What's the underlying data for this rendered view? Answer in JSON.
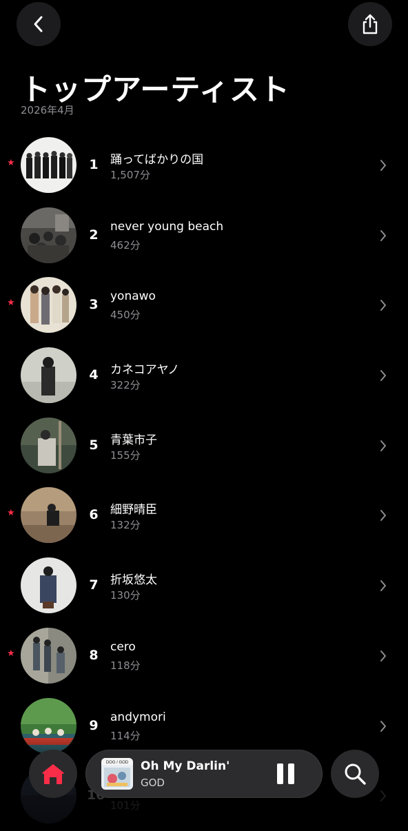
{
  "header": {
    "back_icon": "chevron-left-icon",
    "share_icon": "share-icon"
  },
  "title": "トップアーティスト",
  "subtitle": "2026年4月",
  "accent_color": "#fa2d48",
  "artists": [
    {
      "rank": "1",
      "name": "踊ってばかりの国",
      "minutes": "1,507分",
      "starred": true
    },
    {
      "rank": "2",
      "name": "never young beach",
      "minutes": "462分",
      "starred": false
    },
    {
      "rank": "3",
      "name": "yonawo",
      "minutes": "450分",
      "starred": true
    },
    {
      "rank": "4",
      "name": "カネコアヤノ",
      "minutes": "322分",
      "starred": false
    },
    {
      "rank": "5",
      "name": "青葉市子",
      "minutes": "155分",
      "starred": false
    },
    {
      "rank": "6",
      "name": "細野晴臣",
      "minutes": "132分",
      "starred": true
    },
    {
      "rank": "7",
      "name": "折坂悠太",
      "minutes": "130分",
      "starred": false
    },
    {
      "rank": "8",
      "name": "cero",
      "minutes": "118分",
      "starred": true
    },
    {
      "rank": "9",
      "name": "andymori",
      "minutes": "114分",
      "starred": false
    },
    {
      "rank": "10",
      "name": "",
      "minutes": "101分",
      "starred": false
    }
  ],
  "now_playing": {
    "song": "Oh My Darlin'",
    "artist": "GOD",
    "artwork_text": "DOG / GOD",
    "state_icon": "pause-icon"
  },
  "tab_bar": {
    "home_icon": "home-icon",
    "search_icon": "search-icon"
  }
}
